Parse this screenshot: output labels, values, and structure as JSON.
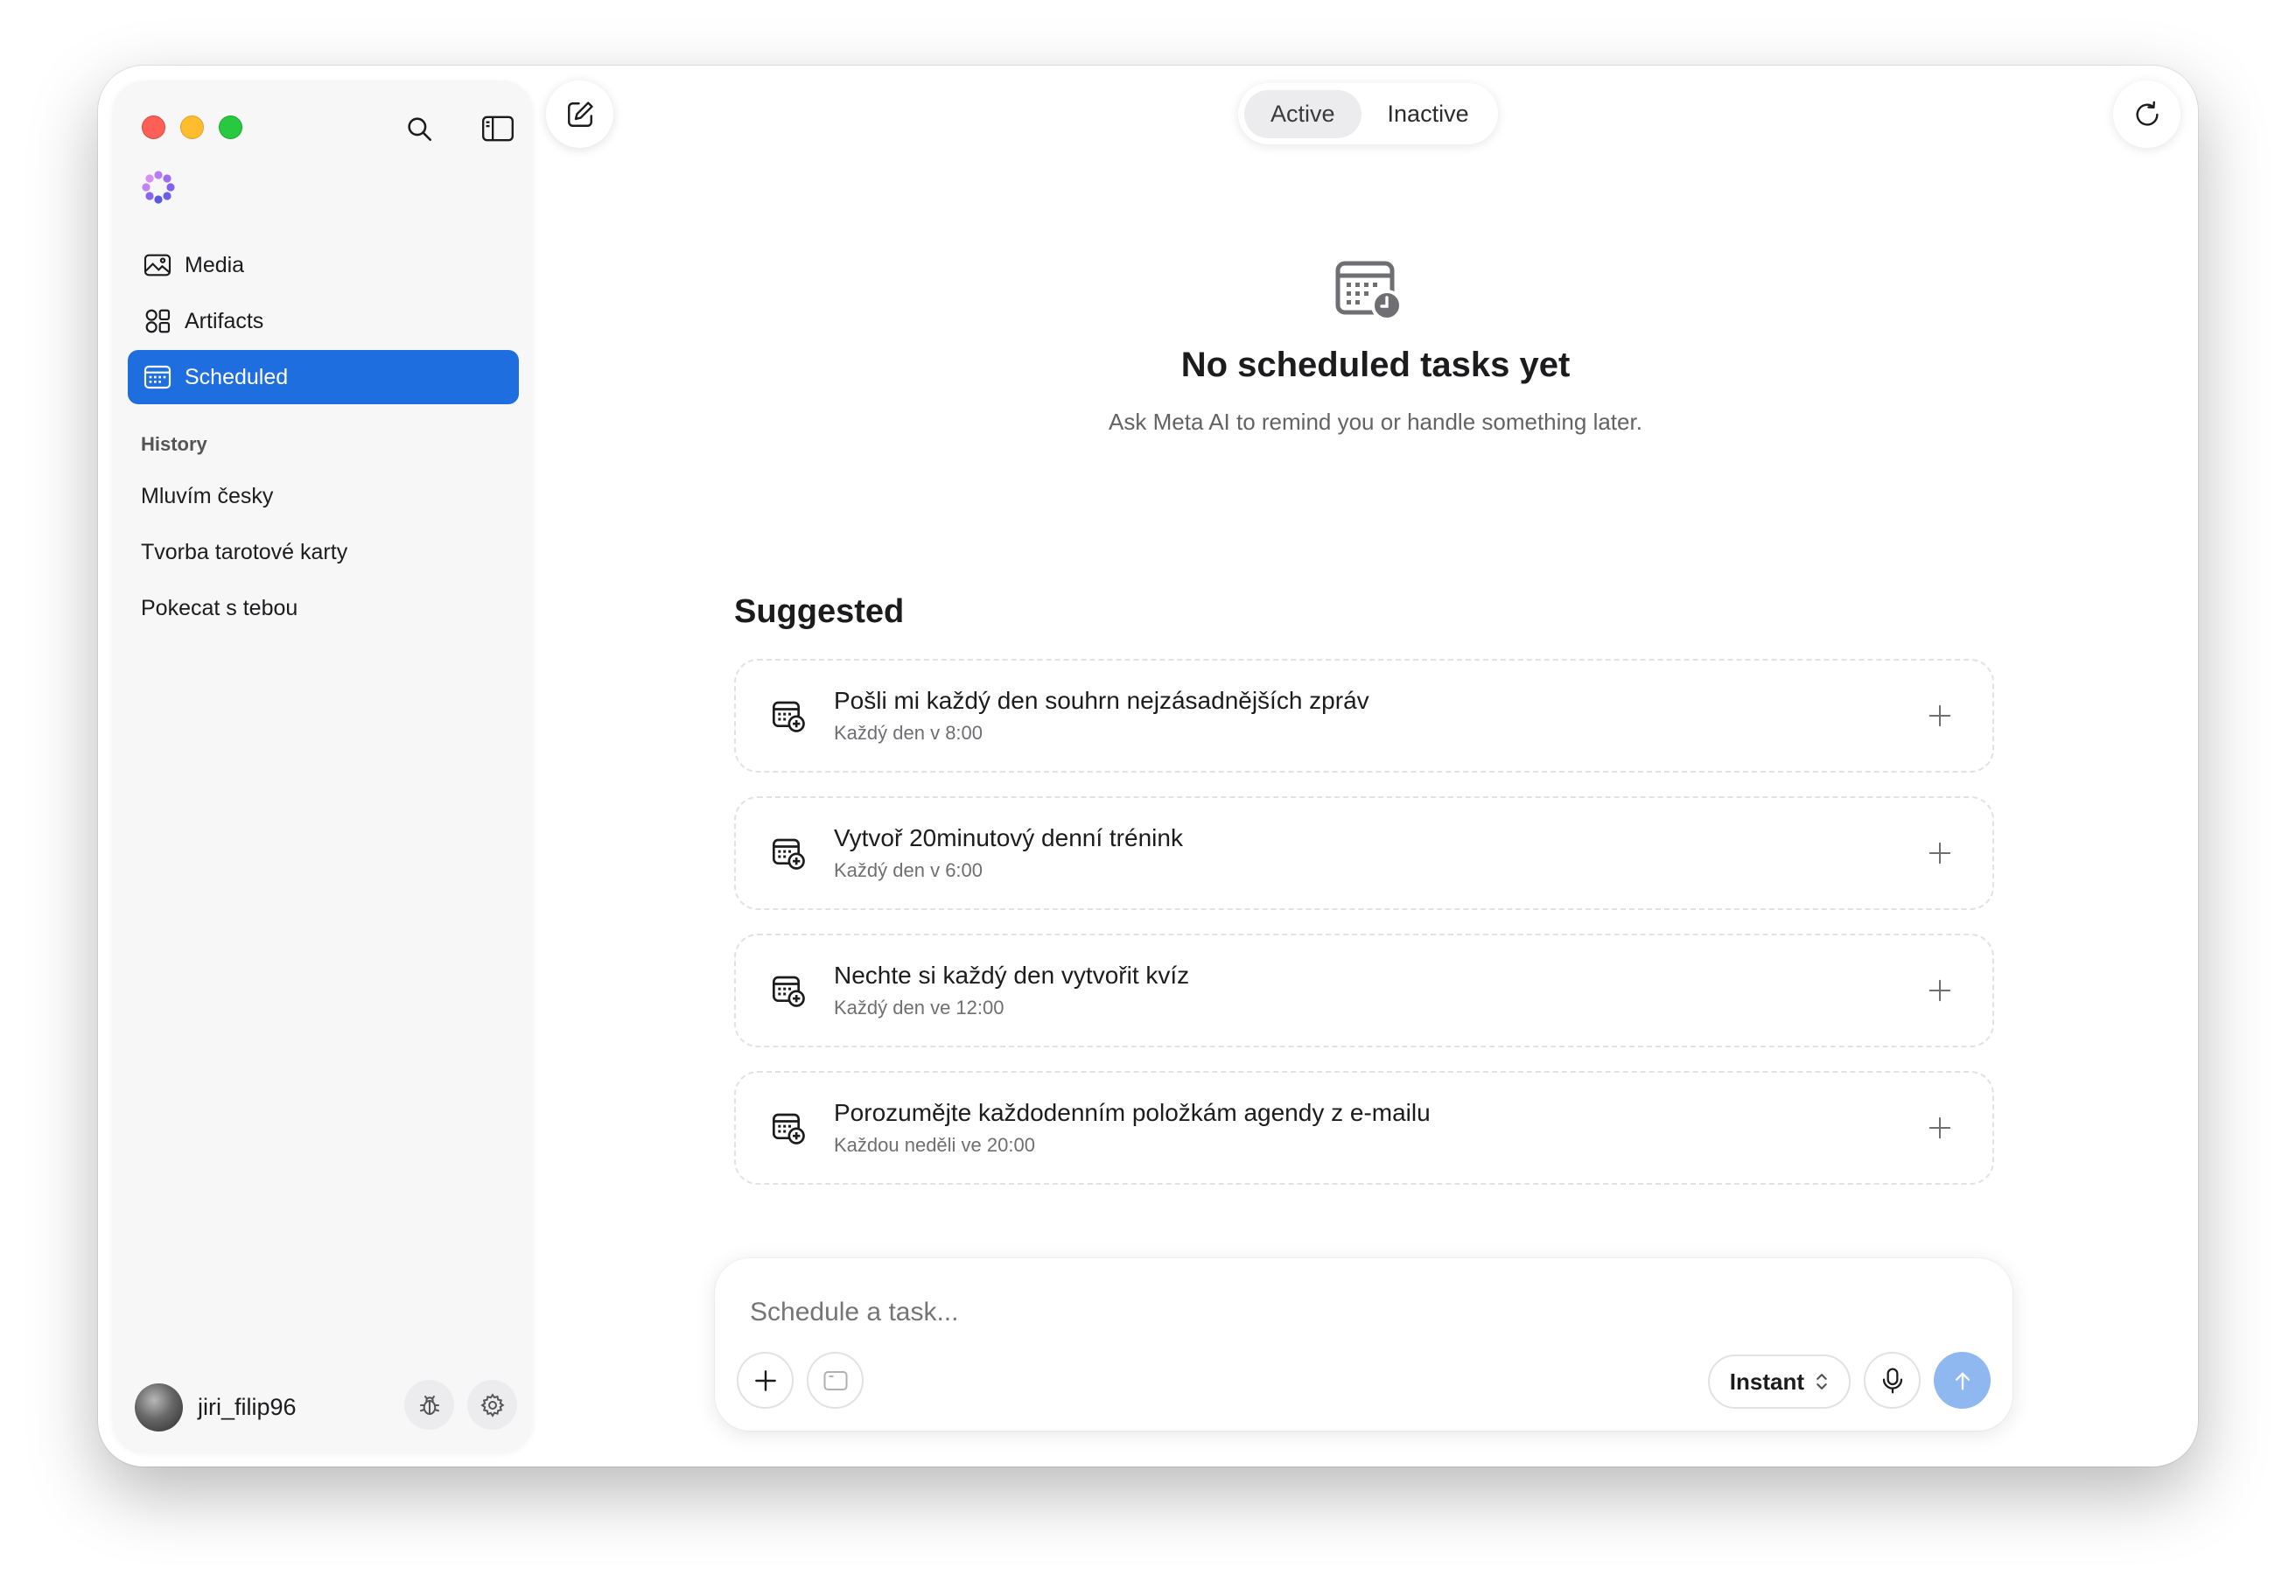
{
  "window": {
    "traffic_lights": [
      "close",
      "minimize",
      "zoom"
    ]
  },
  "sidebar": {
    "icons": {
      "search": "search-icon",
      "toggle": "sidebar-toggle-icon",
      "logo": "meta-ai-logo"
    },
    "nav": [
      {
        "label": "Media",
        "icon": "image-icon",
        "active": false
      },
      {
        "label": "Artifacts",
        "icon": "shapes-icon",
        "active": false
      },
      {
        "label": "Scheduled",
        "icon": "calendar-icon",
        "active": true
      }
    ],
    "history_label": "History",
    "history": [
      "Mluvím česky",
      "Tvorba tarotové karty",
      "Pokecat s tebou"
    ],
    "user": {
      "name": "jiri_filip96"
    }
  },
  "topbar": {
    "tabs": [
      {
        "label": "Active",
        "active": true
      },
      {
        "label": "Inactive",
        "active": false
      }
    ]
  },
  "empty_state": {
    "title": "No scheduled tasks yet",
    "subtitle": "Ask Meta AI to remind you or handle something later."
  },
  "suggested": {
    "title": "Suggested",
    "items": [
      {
        "title": "Pošli mi každý den souhrn nejzásadnějších zpráv",
        "schedule": "Každý den v 8:00"
      },
      {
        "title": "Vytvoř 20minutový denní trénink",
        "schedule": "Každý den v 6:00"
      },
      {
        "title": "Nechte si každý den vytvořit kvíz",
        "schedule": "Každý den ve 12:00"
      },
      {
        "title": "Porozumějte každodenním položkám agendy z e-mailu",
        "schedule": "Každou neděli ve 20:00"
      }
    ]
  },
  "composer": {
    "placeholder": "Schedule a task...",
    "mode": "Instant"
  },
  "colors": {
    "accent": "#1f6ee0",
    "send": "#8fb7f0"
  }
}
